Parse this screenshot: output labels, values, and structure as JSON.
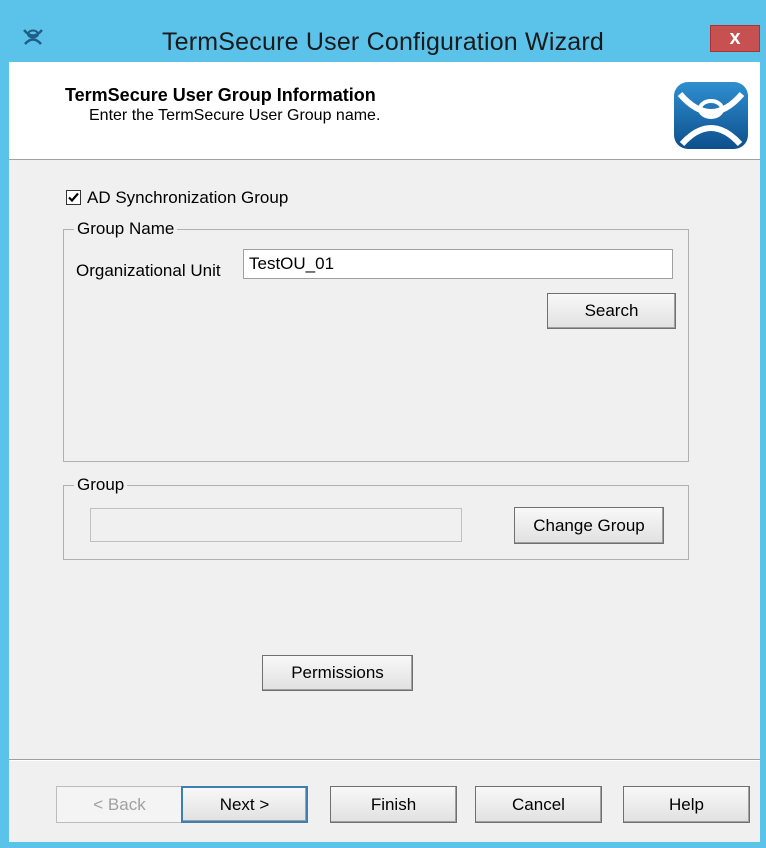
{
  "window": {
    "title": "TermSecure User Configuration Wizard",
    "close_label": "x",
    "colors": {
      "titlebar": "#5bc2ea",
      "close": "#c75050",
      "client": "#f0f0f0"
    }
  },
  "header": {
    "title": "TermSecure User Group Information",
    "subtitle": "Enter the TermSecure User Group name.",
    "logo_icon": "termsecure-logo-icon"
  },
  "ad_sync": {
    "label": "AD Synchronization Group",
    "checked": true
  },
  "group_name": {
    "legend": "Group Name",
    "ou_label": "Organizational Unit",
    "ou_value": "TestOU_01",
    "search_label": "Search"
  },
  "group": {
    "legend": "Group",
    "value": "",
    "change_label": "Change Group"
  },
  "permissions_label": "Permissions",
  "footer": {
    "back_label": "< Back",
    "next_label": "Next >",
    "finish_label": "Finish",
    "cancel_label": "Cancel",
    "help_label": "Help"
  }
}
